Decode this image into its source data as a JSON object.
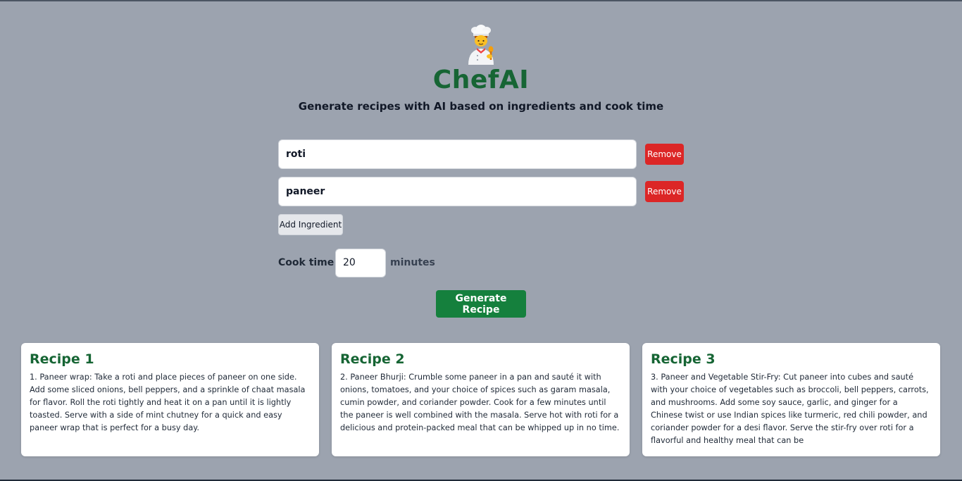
{
  "app": {
    "title": "ChefAI",
    "subtitle": "Generate recipes with AI based on ingredients and cook time"
  },
  "ingredients": [
    {
      "value": "roti",
      "remove_label": "Remove"
    },
    {
      "value": "paneer",
      "remove_label": "Remove"
    }
  ],
  "add_ingredient_label": "Add Ingredient",
  "cook_time": {
    "label": "Cook time",
    "value": "20",
    "unit": "minutes"
  },
  "generate_label": "Generate Recipe",
  "recipes": [
    {
      "title": "Recipe 1",
      "text": "1. Paneer wrap: Take a roti and place pieces of paneer on one side. Add some sliced onions, bell peppers, and a sprinkle of chaat masala for flavor. Roll the roti tightly and heat it on a pan until it is lightly toasted. Serve with a side of mint chutney for a quick and easy paneer wrap that is perfect for a busy day."
    },
    {
      "title": "Recipe 2",
      "text": "2. Paneer Bhurji: Crumble some paneer in a pan and sauté it with onions, tomatoes, and your choice of spices such as garam masala, cumin powder, and coriander powder. Cook for a few minutes until the paneer is well combined with the masala. Serve hot with roti for a delicious and protein-packed meal that can be whipped up in no time."
    },
    {
      "title": "Recipe 3",
      "text": "3. Paneer and Vegetable Stir-Fry: Cut paneer into cubes and sauté with your choice of vegetables such as broccoli, bell peppers, carrots, and mushrooms. Add some soy sauce, garlic, and ginger for a Chinese twist or use Indian spices like turmeric, red chili powder, and coriander powder for a desi flavor. Serve the stir-fry over roti for a flavorful and healthy meal that can be"
    }
  ],
  "colors": {
    "background": "#9ca3af",
    "brand_green": "#166534",
    "button_green": "#15803d",
    "remove_red": "#dc2626"
  },
  "icons": {
    "logo": "chef-icon"
  }
}
